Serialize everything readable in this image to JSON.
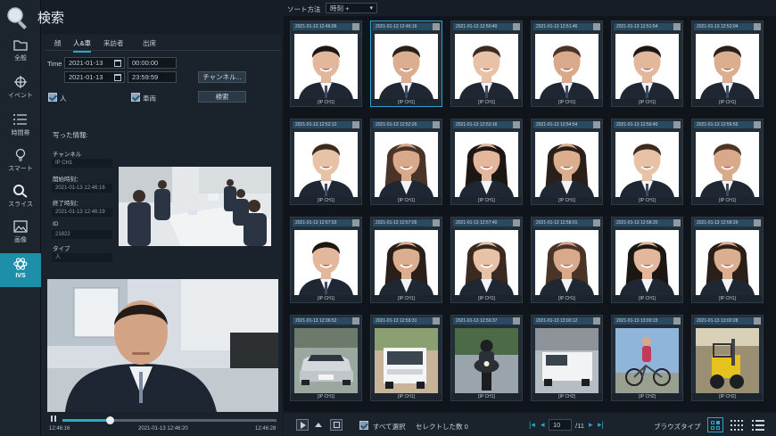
{
  "app": {
    "title": "検索"
  },
  "nav": {
    "items": [
      {
        "label": "全般",
        "icon": "folder-icon"
      },
      {
        "label": "イベント",
        "icon": "crosshair-icon"
      },
      {
        "label": "時間帯",
        "icon": "list-icon"
      },
      {
        "label": "スマート",
        "icon": "bulb-icon"
      },
      {
        "label": "スライス",
        "icon": "search-icon"
      },
      {
        "label": "画像",
        "icon": "image-icon"
      },
      {
        "label": "IVS",
        "icon": "atom-icon"
      }
    ],
    "active": "IVS"
  },
  "tabs": [
    "顔",
    "人&車",
    "来訪者",
    "出席"
  ],
  "filter": {
    "time_label": "Time",
    "start_date": "2021-01-13",
    "start_time": "00:00:00",
    "end_date": "2021-01-13",
    "end_time": "23:59:59",
    "channel_button": "チャンネル...",
    "person_label": "人",
    "vehicle_label": "車両",
    "search_button": "検索"
  },
  "info": {
    "heading": "写った情報:",
    "channel_label": "チャンネル",
    "channel_value": "IP CH1",
    "start_label": "開始時刻：",
    "start_value": "2021-01-13 12:46:16",
    "end_label": "終了時刻：",
    "end_value": "2021-01-13 12:46:19",
    "id_label": "ID",
    "id_value": "21822",
    "type_label": "タイプ",
    "type_value": "人"
  },
  "player": {
    "time_start": "12:46:16",
    "time_mid": "2021-01-13 12:46:20",
    "time_end": "12:46:28",
    "progress": 0.22
  },
  "sort": {
    "label": "ソート方法",
    "value": "時刻 +"
  },
  "results": [
    {
      "ts": "2021-01-13 12:46:06",
      "ch": "[IP CH1]",
      "kind": "face"
    },
    {
      "ts": "2021-01-13 12:46:16",
      "ch": "[IP CH1]",
      "kind": "face"
    },
    {
      "ts": "2021-01-13 12:50:40",
      "ch": "[IP CH1]",
      "kind": "face"
    },
    {
      "ts": "2021-01-13 12:51:46",
      "ch": "[IP CH1]",
      "kind": "face"
    },
    {
      "ts": "2021-01-13 12:51:54",
      "ch": "[IP CH1]",
      "kind": "face"
    },
    {
      "ts": "2021-01-13 12:52:04",
      "ch": "[IP CH1]",
      "kind": "face"
    },
    {
      "ts": "2021-01-13 12:52:12",
      "ch": "[IP CH1]",
      "kind": "face"
    },
    {
      "ts": "2021-01-13 12:52:26",
      "ch": "[IP CH1]",
      "kind": "face"
    },
    {
      "ts": "2021-01-13 12:53:16",
      "ch": "[IP CH1]",
      "kind": "face"
    },
    {
      "ts": "2021-01-13 12:54:54",
      "ch": "[IP CH1]",
      "kind": "face"
    },
    {
      "ts": "2021-01-13 12:56:40",
      "ch": "[IP CH1]",
      "kind": "face"
    },
    {
      "ts": "2021-01-13 12:56:55",
      "ch": "[IP CH1]",
      "kind": "face"
    },
    {
      "ts": "2021-01-13 12:57:03",
      "ch": "[IP CH1]",
      "kind": "face"
    },
    {
      "ts": "2021-01-13 12:57:05",
      "ch": "[IP CH1]",
      "kind": "face"
    },
    {
      "ts": "2021-01-13 12:57:40",
      "ch": "[IP CH1]",
      "kind": "face"
    },
    {
      "ts": "2021-01-13 12:58:01",
      "ch": "[IP CH1]",
      "kind": "face"
    },
    {
      "ts": "2021-01-13 12:58:20",
      "ch": "[IP CH1]",
      "kind": "face"
    },
    {
      "ts": "2021-01-13 12:58:29",
      "ch": "[IP CH1]",
      "kind": "face"
    },
    {
      "ts": "2021-01-13 12:36:52",
      "ch": "[IP CH1]",
      "kind": "car"
    },
    {
      "ts": "2021-01-13 12:59:31",
      "ch": "[IP CH1]",
      "kind": "truck"
    },
    {
      "ts": "2021-01-13 12:59:37",
      "ch": "[IP CH1]",
      "kind": "motorbike"
    },
    {
      "ts": "2021-01-13 13:00:12",
      "ch": "[IP CH2]",
      "kind": "van"
    },
    {
      "ts": "2021-01-13 13:00:15",
      "ch": "[IP CH2]",
      "kind": "bicycle"
    },
    {
      "ts": "2021-01-13 13:00:28",
      "ch": "[IP CH2]",
      "kind": "forklift"
    }
  ],
  "selected_index": 1,
  "bottom": {
    "select_all": "すべて選択",
    "selected_count": "セレクトした数 0",
    "page": "10",
    "total_pages": "/11",
    "browse_type": "ブラウズタイプ"
  },
  "colors": {
    "accent": "#2aa7c6",
    "panel": "#1a232c",
    "background": "#0f151b"
  }
}
